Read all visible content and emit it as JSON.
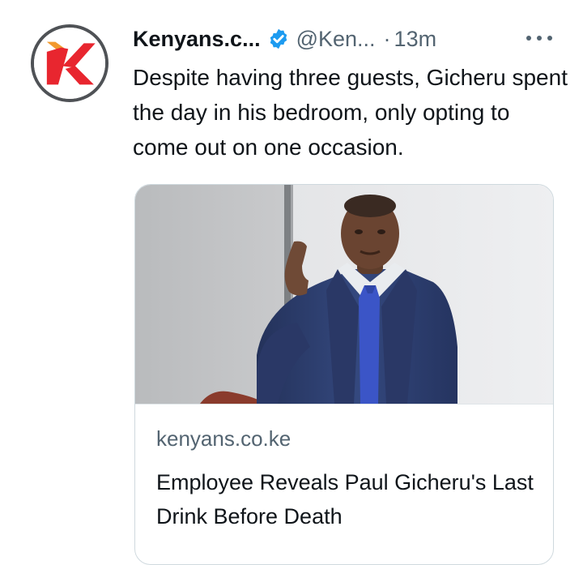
{
  "tweet": {
    "author_name": "Kenyans.c...",
    "handle": "@Ken...",
    "separator": "·",
    "time": "13m",
    "text": "Despite having three guests, Gicheru spent the day in his bedroom, only opting to come out on one occasion.",
    "verified_icon": "verified-badge-icon",
    "more_icon": "more-options-icon"
  },
  "card": {
    "domain": "kenyans.co.ke",
    "title": "Employee Reveals Paul Gicheru's Last Drink Before Death"
  },
  "colors": {
    "brand_red": "#e8262f",
    "verified_blue": "#1d9bf0",
    "secondary_text": "#536471",
    "suit_blue": "#2b3a66",
    "tie_blue": "#3b55c7"
  }
}
